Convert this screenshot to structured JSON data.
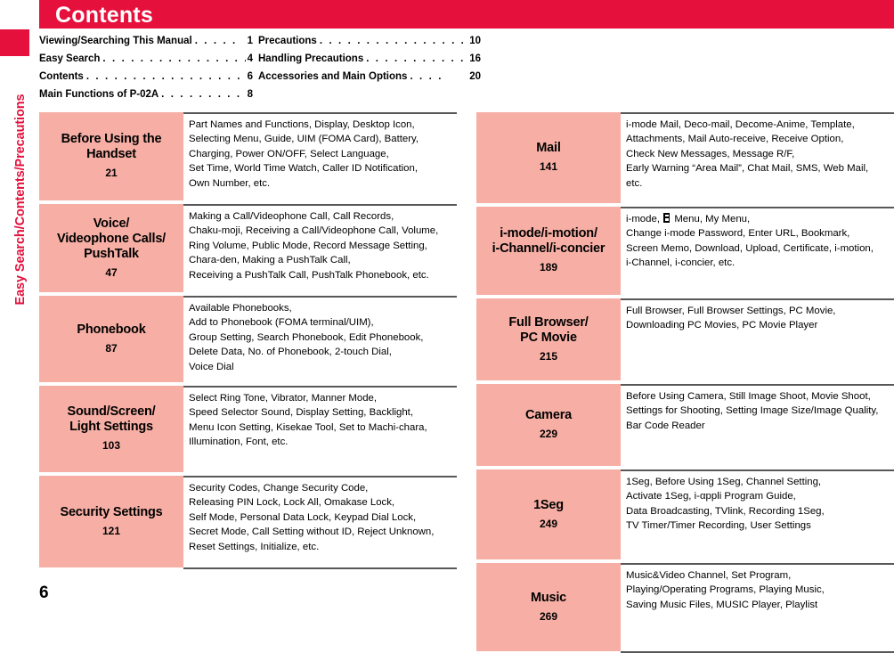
{
  "side_tab": {
    "label": "Easy Search/Contents/Precautions"
  },
  "header": {
    "title": "Contents"
  },
  "colors": {
    "accent_red": "#E5103C",
    "cell_pink": "#F7AFA5",
    "rule_gray": "#58585A"
  },
  "toc": {
    "left": [
      {
        "label": "Viewing/Searching This Manual",
        "dots": ". . . . .",
        "page": "1"
      },
      {
        "label": "Easy Search",
        "dots": ". . . . . . . . . . . . . . . . . . . . . .",
        "page": "4"
      },
      {
        "label": "Contents",
        "dots": ". . . . . . . . . . . . . . . . . . . . . . . . .",
        "page": "6"
      },
      {
        "label": "Main Functions of P-02A",
        "dots": ". . . . . . . . . . .",
        "page": "8"
      }
    ],
    "right": [
      {
        "label": "Precautions",
        "dots": ". . . . . . . . . . . . . . . . . . . . .",
        "page": "10"
      },
      {
        "label": "Handling Precautions",
        "dots": ". . . . . . . . . . . .",
        "page": "16"
      },
      {
        "label": "Accessories and Main Options",
        "dots": ". . . .",
        "page": "20"
      }
    ]
  },
  "table_left": [
    {
      "name": "Before Using the Handset",
      "page": "21",
      "desc": [
        "Part Names and Functions, Display, Desktop Icon,",
        "Selecting Menu, Guide, UIM (FOMA Card), Battery,",
        "Charging, Power ON/OFF, Select Language,",
        "Set Time, World Time Watch, Caller ID Notification,",
        "Own Number, etc."
      ]
    },
    {
      "name": "Voice/ Videophone Calls/ PushTalk",
      "page": "47",
      "desc": [
        "Making a Call/Videophone Call, Call Records,",
        "Chaku-moji, Receiving a Call/Videophone Call, Volume,",
        "Ring Volume, Public Mode, Record Message Setting,",
        "Chara-den, Making a PushTalk Call,",
        "Receiving a PushTalk Call, PushTalk Phonebook, etc."
      ]
    },
    {
      "name": "Phonebook",
      "page": "87",
      "desc": [
        "Available Phonebooks,",
        "Add to Phonebook (FOMA terminal/UIM),",
        "Group Setting, Search Phonebook, Edit Phonebook,",
        "Delete Data, No. of Phonebook, 2-touch Dial,",
        "Voice Dial"
      ]
    },
    {
      "name": "Sound/Screen/ Light Settings",
      "page": "103",
      "desc": [
        "Select Ring Tone, Vibrator, Manner Mode,",
        "Speed Selector Sound, Display Setting, Backlight,",
        "Menu Icon Setting, Kisekae Tool, Set to Machi-chara,",
        "Illumination, Font, etc."
      ]
    },
    {
      "name": "Security Settings",
      "page": "121",
      "desc": [
        "Security Codes, Change Security Code,",
        "Releasing PIN Lock, Lock All, Omakase Lock,",
        "Self Mode, Personal Data Lock, Keypad Dial Lock,",
        "Secret Mode, Call Setting without ID, Reject Unknown,",
        "Reset Settings, Initialize, etc."
      ]
    }
  ],
  "table_right": [
    {
      "name": "Mail",
      "page": "141",
      "desc": [
        "i-mode Mail, Deco-mail, Decome-Anime, Template,",
        "Attachments, Mail Auto-receive, Receive Option,",
        "Check New Messages, Message R/F,",
        "Early Warning “Area Mail”, Chat Mail, SMS, Web Mail,",
        "etc."
      ]
    },
    {
      "name": "i-mode/i-motion/ i-Channel/i-concier",
      "page": "189",
      "desc_first_prefix": "i-mode, ",
      "desc_first_suffix": " Menu, My Menu,",
      "desc": [
        "Change i-mode Password, Enter URL, Bookmark,",
        "Screen Memo, Download, Upload, Certificate, i-motion,",
        "i-Channel, i-concier, etc."
      ]
    },
    {
      "name": "Full Browser/ PC Movie",
      "page": "215",
      "desc": [
        "Full Browser, Full Browser Settings, PC Movie,",
        "Downloading PC Movies, PC Movie Player"
      ]
    },
    {
      "name": "Camera",
      "page": "229",
      "desc": [
        "Before Using Camera, Still Image Shoot, Movie Shoot,",
        "Settings for Shooting, Setting Image Size/Image Quality,",
        "Bar Code Reader"
      ]
    },
    {
      "name": "1Seg",
      "page": "249",
      "desc": [
        "1Seg, Before Using 1Seg, Channel Setting,",
        "Activate 1Seg, i-αppli Program Guide,",
        "Data Broadcasting, TVlink, Recording 1Seg,",
        "TV Timer/Timer Recording, User Settings"
      ]
    },
    {
      "name": "Music",
      "page": "269",
      "desc": [
        "Music&Video Channel, Set Program,",
        "Playing/Operating Programs, Playing Music,",
        "Saving Music Files, MUSIC Player, Playlist"
      ]
    }
  ],
  "footer": {
    "page_number": "6"
  }
}
